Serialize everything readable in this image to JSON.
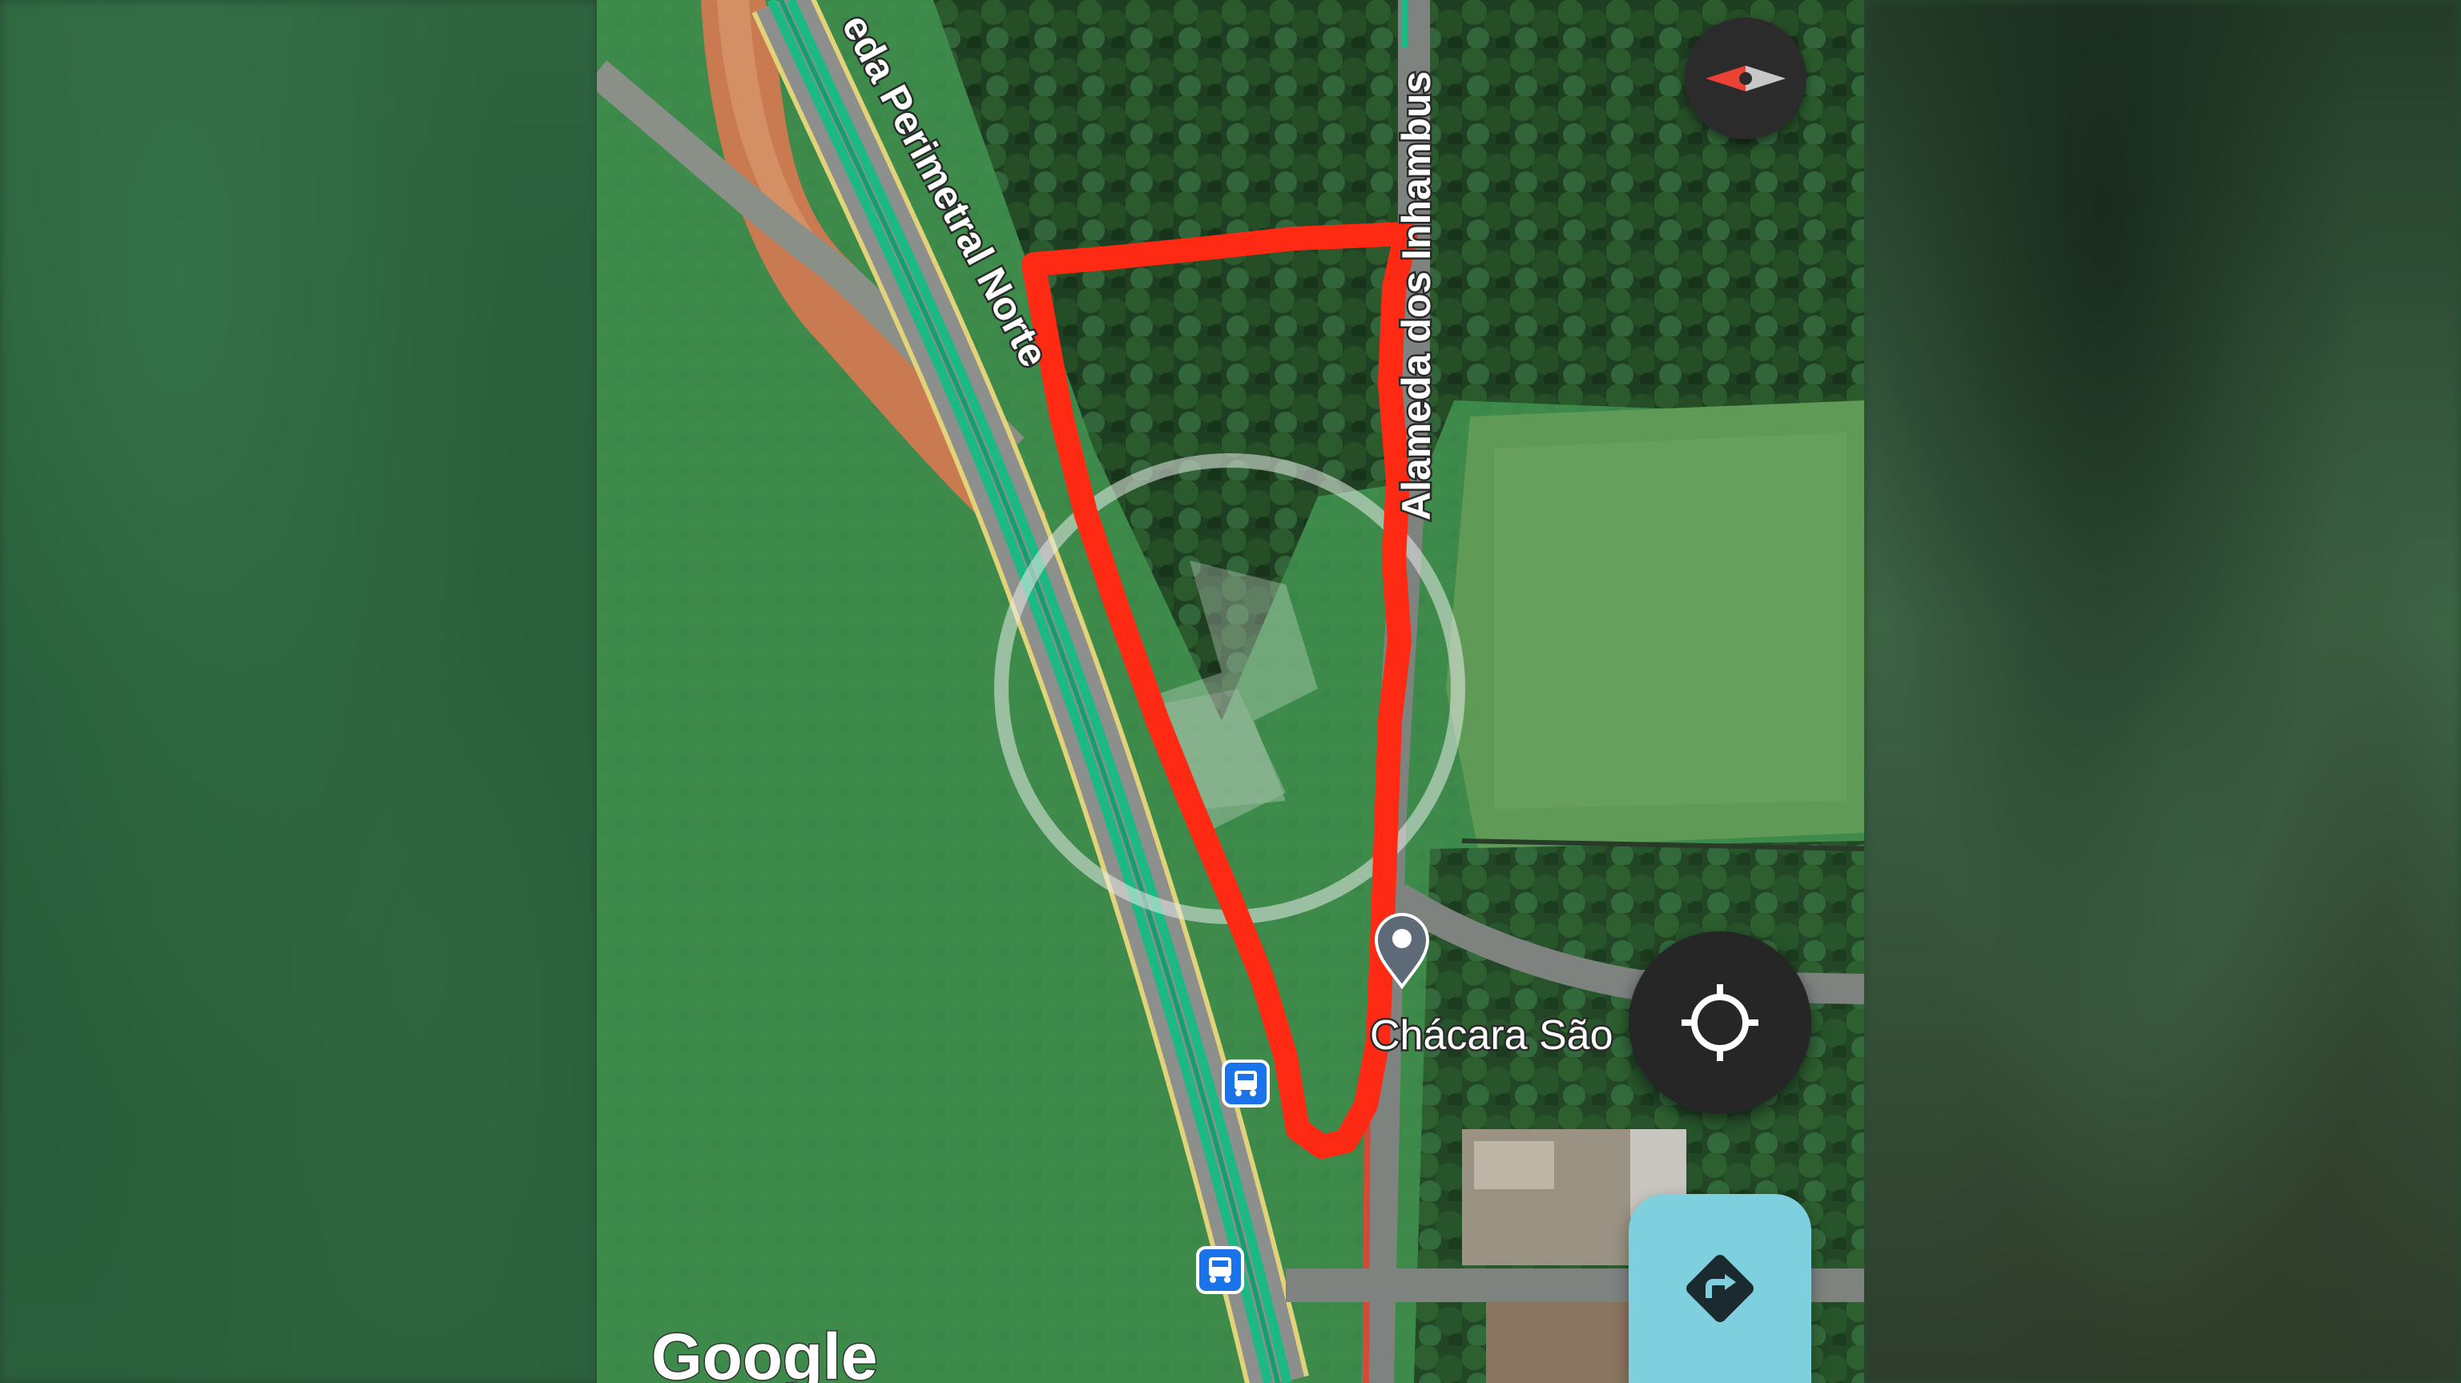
{
  "map": {
    "road_labels": [
      {
        "id": "perimetral",
        "text": "eda Perimetral Norte"
      },
      {
        "id": "alameda",
        "text": "Alameda dos Inhambus"
      }
    ],
    "place_labels": [
      {
        "id": "chacara",
        "text": "Chácara São"
      }
    ],
    "attribution": "Google",
    "markers": [
      {
        "type": "bus-stop-icon"
      },
      {
        "type": "bus-stop-icon"
      },
      {
        "type": "location-pin-icon"
      }
    ],
    "overlay": {
      "type": "hand-drawn-boundary",
      "color": "#ff2a14"
    },
    "watermark": {
      "type": "circular-logo-watermark"
    }
  },
  "controls": {
    "compass": {
      "icon": "compass-icon"
    },
    "my_location": {
      "icon": "crosshair-icon"
    },
    "directions": {
      "icon": "directions-arrow-icon",
      "color": "#7fd0de"
    }
  },
  "colors": {
    "transit_line": "#1db984",
    "road_edge": "#e2d27a",
    "boundary": "#ff2a14",
    "directions_button": "#7fd0de"
  }
}
